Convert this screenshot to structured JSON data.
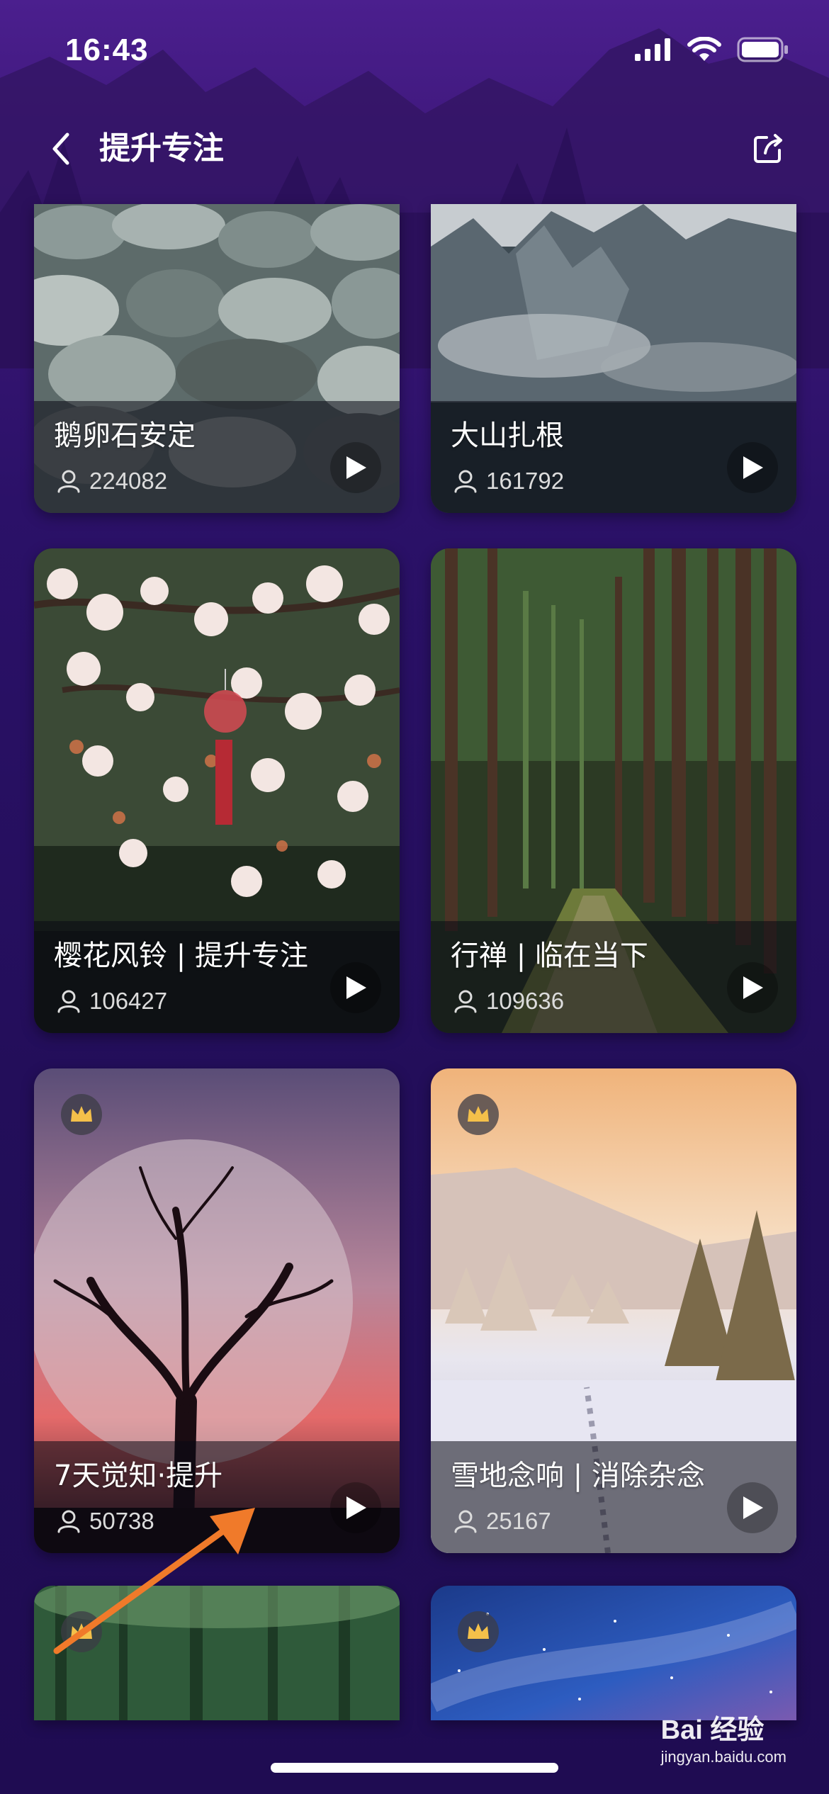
{
  "status_bar": {
    "time": "16:43"
  },
  "nav": {
    "title": "提升专注"
  },
  "cards": [
    {
      "title": "鹅卵石安定",
      "count": "224082",
      "premium": false
    },
    {
      "title": "大山扎根",
      "count": "161792",
      "premium": false
    },
    {
      "title": "樱花风铃 | 提升专注",
      "count": "106427",
      "premium": false
    },
    {
      "title": "行禅 | 临在当下",
      "count": "109636",
      "premium": false
    },
    {
      "title": "7天觉知·提升",
      "count": "50738",
      "premium": true
    },
    {
      "title": "雪地念响 | 消除杂念",
      "count": "25167",
      "premium": true
    },
    {
      "premium": true
    },
    {
      "premium": true
    }
  ],
  "watermark": {
    "brand": "Bai 经验",
    "url": "jingyan.baidu.com"
  },
  "colors": {
    "background": "#2a1163",
    "overlay": "rgba(10,10,20,0.55)",
    "arrow": "#f07a2a"
  }
}
